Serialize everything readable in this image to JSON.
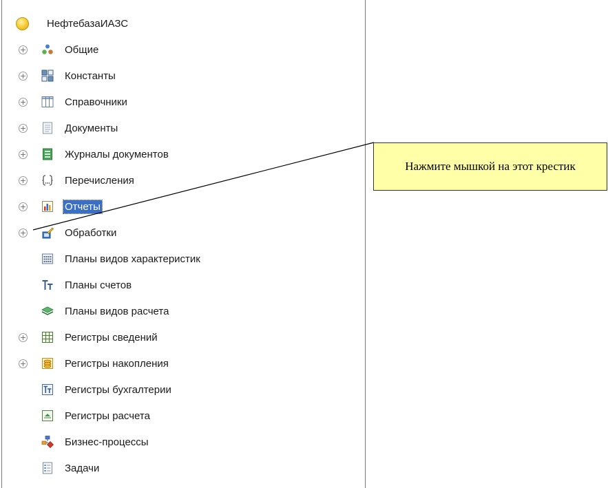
{
  "tree": {
    "root_label": "НефтебазаИАЗС",
    "items": [
      {
        "label": "Общие",
        "expandable": true,
        "icon": "people-icon"
      },
      {
        "label": "Константы",
        "expandable": true,
        "icon": "constants-icon"
      },
      {
        "label": "Справочники",
        "expandable": true,
        "icon": "catalogs-icon"
      },
      {
        "label": "Документы",
        "expandable": true,
        "icon": "documents-icon"
      },
      {
        "label": "Журналы документов",
        "expandable": true,
        "icon": "journal-icon"
      },
      {
        "label": "Перечисления",
        "expandable": true,
        "icon": "enumerations-icon"
      },
      {
        "label": "Отчеты",
        "expandable": true,
        "icon": "reports-icon",
        "selected": true
      },
      {
        "label": "Обработки",
        "expandable": true,
        "icon": "data-processors-icon"
      },
      {
        "label": "Планы видов характеристик",
        "expandable": false,
        "icon": "chart-of-characteristic-types-icon"
      },
      {
        "label": "Планы счетов",
        "expandable": false,
        "icon": "chart-of-accounts-icon"
      },
      {
        "label": "Планы видов расчета",
        "expandable": false,
        "icon": "chart-of-calculation-types-icon"
      },
      {
        "label": "Регистры сведений",
        "expandable": true,
        "icon": "information-registers-icon"
      },
      {
        "label": "Регистры накопления",
        "expandable": true,
        "icon": "accumulation-registers-icon"
      },
      {
        "label": "Регистры бухгалтерии",
        "expandable": false,
        "icon": "accounting-registers-icon"
      },
      {
        "label": "Регистры расчета",
        "expandable": false,
        "icon": "calculation-registers-icon"
      },
      {
        "label": "Бизнес-процессы",
        "expandable": false,
        "icon": "business-processes-icon"
      },
      {
        "label": "Задачи",
        "expandable": false,
        "icon": "tasks-icon"
      }
    ],
    "expander_glyph": "+"
  },
  "callout": {
    "text": "Нажмите мышкой на этот крестик"
  },
  "colors": {
    "selection": "#3b6fc6",
    "callout_bg": "#ffffa8"
  }
}
